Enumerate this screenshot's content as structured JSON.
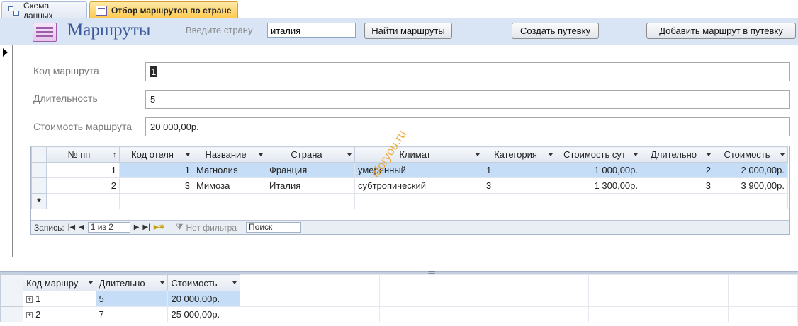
{
  "tabs": [
    {
      "label": "Схема данных"
    },
    {
      "label": "Отбор маршрутов по стране"
    }
  ],
  "header": {
    "title": "Маршруты",
    "country_label": "Введите страну",
    "country_value": "италия",
    "find_button": "Найти маршруты",
    "create_button": "Создать путёвку",
    "add_button": "Добавить маршрут в путёвку"
  },
  "form": {
    "route_code_label": "Код маршрута",
    "route_code_value": "1",
    "duration_label": "Длительность",
    "duration_value": "5",
    "cost_label": "Стоимость маршрута",
    "cost_value": "20 000,00р."
  },
  "subform": {
    "columns": [
      "№ пп",
      "Код отеля",
      "Название",
      "Страна",
      "Климат",
      "Категория",
      "Стоимость сут",
      "Длительно",
      "Стоимость"
    ],
    "rows": [
      [
        "1",
        "1",
        "Магнолия",
        "Франция",
        "умеренный",
        "1",
        "1 000,00р.",
        "2",
        "2 000,00р."
      ],
      [
        "2",
        "3",
        "Мимоза",
        "Италия",
        "субтропический",
        "3",
        "1 300,00р.",
        "3",
        "3 900,00р."
      ]
    ],
    "new_row_marker": "*"
  },
  "navigator": {
    "record_label": "Запись:",
    "position": "1 из 2",
    "filter_label": "Нет фильтра",
    "search_label": "Поиск"
  },
  "bottom_sheet": {
    "columns": [
      "Код маршру",
      "Длительно",
      "Стоимость"
    ],
    "rows": [
      [
        "1",
        "5",
        "20 000,00р."
      ],
      [
        "2",
        "7",
        "25 000,00р."
      ]
    ]
  },
  "watermark": "itforyou.ru",
  "colors": {
    "header_band": "#d9e4f4",
    "active_tab": "#ffc94d",
    "highlight": "#c5ddf6",
    "title": "#3b5998"
  }
}
